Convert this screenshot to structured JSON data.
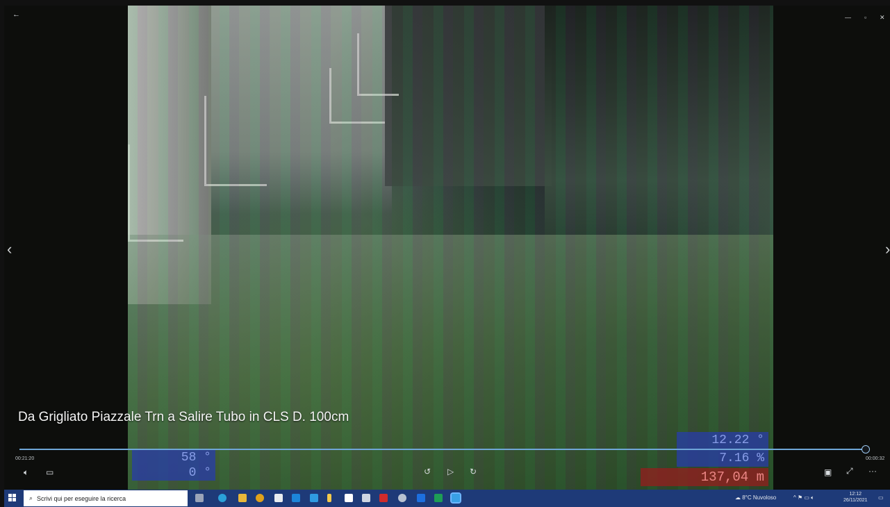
{
  "video": {
    "caption": "Da Grigliato Piazzale Trn a Salire Tubo in CLS D. 100cm",
    "readouts": {
      "left_top": "58 °",
      "left_bottom": "0 °",
      "right_top": "12.22 °",
      "right_mid": "7.16 %",
      "right_bottom": "137,04 m"
    }
  },
  "player": {
    "time_current": "00:21:20",
    "time_total": "00:00:32",
    "progress": 0.995
  },
  "taskbar": {
    "search_placeholder": "Scrivi qui per eseguire la ricerca",
    "weather": "8°C Nuvoloso",
    "clock_time": "12:12",
    "clock_date": "26/11/2021",
    "accent": "#1e3a78"
  }
}
